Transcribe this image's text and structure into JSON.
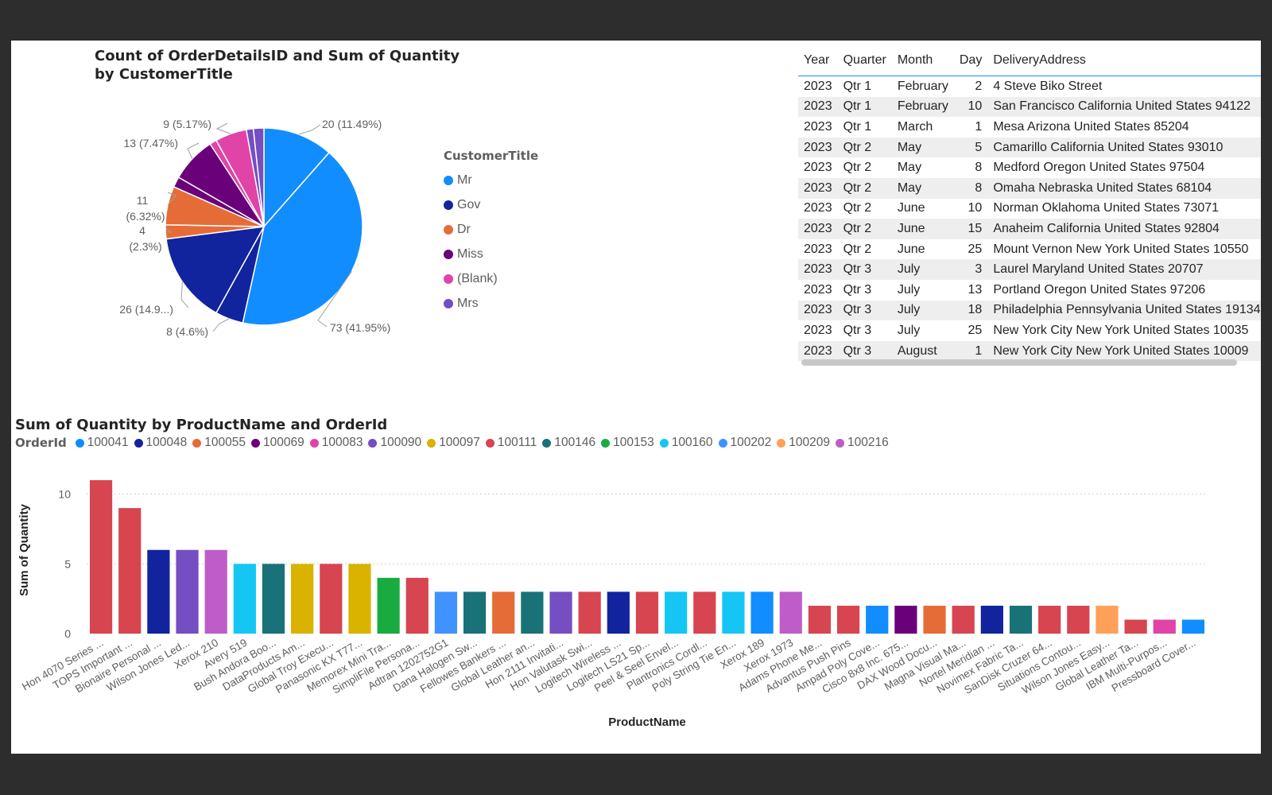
{
  "pie_chart": {
    "title": "Count of OrderDetailsID and Sum of Quantity by CustomerTitle",
    "legend_title": "CustomerTitle"
  },
  "table": {
    "columns": [
      "Year",
      "Quarter",
      "Month",
      "Day",
      "DeliveryAddress"
    ],
    "rows": [
      [
        "2023",
        "Qtr 1",
        "February",
        "2",
        "4 Steve Biko Street"
      ],
      [
        "2023",
        "Qtr 1",
        "February",
        "10",
        "San Francisco California United States 94122"
      ],
      [
        "2023",
        "Qtr 1",
        "March",
        "1",
        "Mesa Arizona United States 85204"
      ],
      [
        "2023",
        "Qtr 2",
        "May",
        "5",
        "Camarillo California United States 93010"
      ],
      [
        "2023",
        "Qtr 2",
        "May",
        "8",
        "Medford Oregon United States 97504"
      ],
      [
        "2023",
        "Qtr 2",
        "May",
        "8",
        "Omaha Nebraska United States 68104"
      ],
      [
        "2023",
        "Qtr 2",
        "June",
        "10",
        "Norman Oklahoma United States 73071"
      ],
      [
        "2023",
        "Qtr 2",
        "June",
        "15",
        "Anaheim California United States 92804"
      ],
      [
        "2023",
        "Qtr 2",
        "June",
        "25",
        "Mount Vernon New York United States 10550"
      ],
      [
        "2023",
        "Qtr 3",
        "July",
        "3",
        "Laurel Maryland United States 20707"
      ],
      [
        "2023",
        "Qtr 3",
        "July",
        "13",
        "Portland Oregon United States 97206"
      ],
      [
        "2023",
        "Qtr 3",
        "July",
        "18",
        "Philadelphia Pennsylvania United States 19134"
      ],
      [
        "2023",
        "Qtr 3",
        "July",
        "25",
        "New York City New York United States 10035"
      ],
      [
        "2023",
        "Qtr 3",
        "August",
        "1",
        "New York City New York United States 10009"
      ]
    ]
  },
  "bar_chart": {
    "title": "Sum of Quantity by ProductName and OrderId",
    "legend_title": "OrderId"
  },
  "chart_data": [
    {
      "type": "pie",
      "title": "Count of OrderDetailsID and Sum of Quantity by CustomerTitle",
      "legend_title": "CustomerTitle",
      "slices": [
        {
          "label": "Mr",
          "value": 20,
          "data_label": "20 (11.49%)",
          "color": "#118DFF"
        },
        {
          "label": "Mr",
          "value": 73,
          "data_label": "73 (41.95%)",
          "color": "#118DFF"
        },
        {
          "label": "Gov",
          "value": 8,
          "data_label": "8 (4.6%)",
          "color": "#12239E"
        },
        {
          "label": "Gov",
          "value": 26,
          "data_label": "26 (14.9...)",
          "color": "#12239E"
        },
        {
          "label": "Dr",
          "value": 4,
          "data_label": "4 (2.3%)",
          "color": "#E66C37"
        },
        {
          "label": "Dr",
          "value": 11,
          "data_label": "11 (6.32%)",
          "color": "#E66C37"
        },
        {
          "label": "Miss",
          "value": 3,
          "data_label": "",
          "color": "#6B007B"
        },
        {
          "label": "Miss",
          "value": 13,
          "data_label": "13 (7.47%)",
          "color": "#6B007B"
        },
        {
          "label": "(Blank)",
          "value": 2,
          "data_label": "",
          "color": "#E044A7"
        },
        {
          "label": "(Blank)",
          "value": 9,
          "data_label": "9 (5.17%)",
          "color": "#E044A7"
        },
        {
          "label": "Mrs",
          "value": 2,
          "data_label": "",
          "color": "#744EC2"
        },
        {
          "label": "Mrs",
          "value": 3,
          "data_label": "",
          "color": "#744EC2"
        }
      ],
      "legend": [
        {
          "label": "Mr",
          "color": "#118DFF"
        },
        {
          "label": "Gov",
          "color": "#12239E"
        },
        {
          "label": "Dr",
          "color": "#E66C37"
        },
        {
          "label": "Miss",
          "color": "#6B007B"
        },
        {
          "label": "(Blank)",
          "color": "#E044A7"
        },
        {
          "label": "Mrs",
          "color": "#744EC2"
        }
      ]
    },
    {
      "type": "bar",
      "title": "Sum of Quantity by ProductName and OrderId",
      "xlabel": "ProductName",
      "ylabel": "Sum of Quantity",
      "ylim": [
        0,
        11
      ],
      "yticks": [
        0,
        5,
        10
      ],
      "grid": true,
      "legend_title": "OrderId",
      "legend_placement": "top-left",
      "legend": [
        {
          "label": "100041",
          "color": "#118DFF"
        },
        {
          "label": "100048",
          "color": "#12239E"
        },
        {
          "label": "100055",
          "color": "#E66C37"
        },
        {
          "label": "100069",
          "color": "#6B007B"
        },
        {
          "label": "100083",
          "color": "#E044A7"
        },
        {
          "label": "100090",
          "color": "#744EC2"
        },
        {
          "label": "100097",
          "color": "#D9B300"
        },
        {
          "label": "100111",
          "color": "#D64550"
        },
        {
          "label": "100146",
          "color": "#197278"
        },
        {
          "label": "100153",
          "color": "#1AAB40"
        },
        {
          "label": "100160",
          "color": "#15C6F4"
        },
        {
          "label": "100202",
          "color": "#4092FF"
        },
        {
          "label": "100209",
          "color": "#FFA058"
        },
        {
          "label": "100216",
          "color": "#BE5DC9"
        }
      ],
      "categories": [
        "Hon 4070 Series ...",
        "TOPS Important ...",
        "Bionaire Personal ...",
        "Wilson Jones Led...",
        "Xerox 210",
        "Avery 519",
        "Bush Andora Boo...",
        "DataProducts Am...",
        "Global Troy Execu...",
        "Panasonic KX T77...",
        "Memorex Mini Tra...",
        "SimpliFile Persona...",
        "Adtran 1202752G1",
        "Dana Halogen Sw...",
        "Fellowes Bankers ...",
        "Global Leather an...",
        "Hon 2111 Invitati...",
        "Hon Valutask Swi...",
        "Logitech Wireless ...",
        "Logitech LS21 Sp...",
        "Peel & Seel Envel...",
        "Plantronics Cordl...",
        "Poly String Tie En...",
        "Xerox 189",
        "Xerox 1973",
        "Adams Phone Me...",
        "Advantus Push Pins",
        "Ampad Poly Cove...",
        "Cisco 8x8 Inc. 675...",
        "DAX Wood Docu...",
        "Magna Visual Ma...",
        "Nortel Meridian ...",
        "Novimex Fabric Ta...",
        "SanDisk Cruzer 64...",
        "Situations Contou...",
        "Wilson Jones Easy...",
        "Global Leather Ta...",
        "IBM Multi-Purpos...",
        "Pressboard Cover..."
      ],
      "values": [
        11,
        9,
        6,
        6,
        6,
        5,
        5,
        5,
        5,
        5,
        4,
        4,
        3,
        3,
        3,
        3,
        3,
        3,
        3,
        3,
        3,
        3,
        3,
        3,
        3,
        2,
        2,
        2,
        2,
        2,
        2,
        2,
        2,
        2,
        2,
        2,
        1,
        1,
        1
      ],
      "series_of_bar": [
        "100111",
        "100111",
        "100048",
        "100090",
        "100216",
        "100160",
        "100146",
        "100097",
        "100111",
        "100097",
        "100153",
        "100111",
        "100202",
        "100146",
        "100055",
        "100146",
        "100090",
        "100111",
        "100048",
        "100111",
        "100160",
        "100111",
        "100160",
        "100041",
        "100216",
        "100111",
        "100111",
        "100041",
        "100069",
        "100055",
        "100111",
        "100048",
        "100146",
        "100111",
        "100111",
        "100209",
        "100111",
        "100083",
        "100041"
      ]
    }
  ]
}
